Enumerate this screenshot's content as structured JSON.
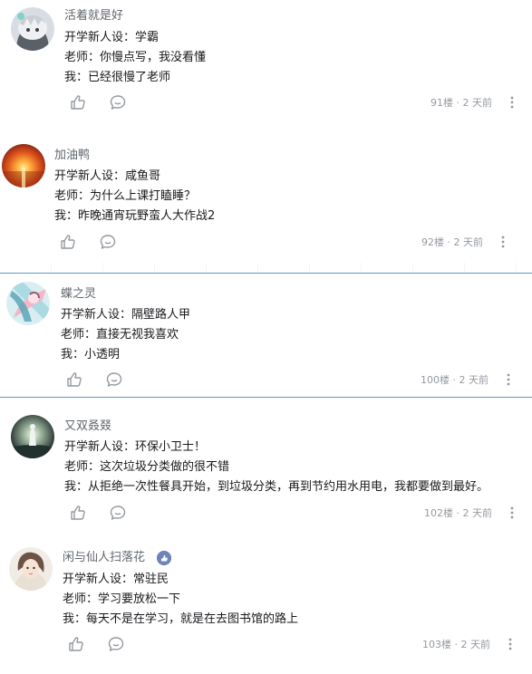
{
  "comments": [
    {
      "username": "活着就是好",
      "lines": [
        "开学新人设：学霸",
        "老师：你慢点写，我没看懂",
        "我：已经很慢了老师"
      ],
      "floor_time": "91楼 · 2 天前"
    },
    {
      "username": "加油鸭",
      "lines": [
        "开学新人设：咸鱼哥",
        "老师：为什么上课打瞌睡？",
        "我：昨晚通宵玩野蛮人大作战2"
      ],
      "floor_time": "92楼 · 2 天前"
    },
    {
      "username": "蝶之灵",
      "lines": [
        "开学新人设：隔壁路人甲",
        "老师：直接无视我喜欢",
        "我：小透明"
      ],
      "floor_time": "100楼 · 2 天前"
    },
    {
      "username": "又双叒叕",
      "lines": [
        "开学新人设：环保小卫士！",
        "老师：这次垃圾分类做的很不错",
        "我：从拒绝一次性餐具开始，到垃圾分类，再到节约用水用电，我都要做到最好。"
      ],
      "floor_time": "102楼 · 2 天前"
    },
    {
      "username": "闲与仙人扫落花",
      "lines": [
        "开学新人设：常驻民",
        "老师：学习要放松一下",
        "我：每天不是在学习，就是在去图书馆的路上"
      ],
      "floor_time": "103楼 · 2 天前"
    }
  ],
  "icons": {
    "like": "thumbs-up-icon",
    "reply": "chat-bubble-icon",
    "more": "more-vertical-icon",
    "badge": "verified-hand-badge-icon"
  },
  "colors": {
    "username": "#61666d",
    "text": "#18191c",
    "meta": "#9499a0",
    "separator": "#4e9ed0"
  }
}
